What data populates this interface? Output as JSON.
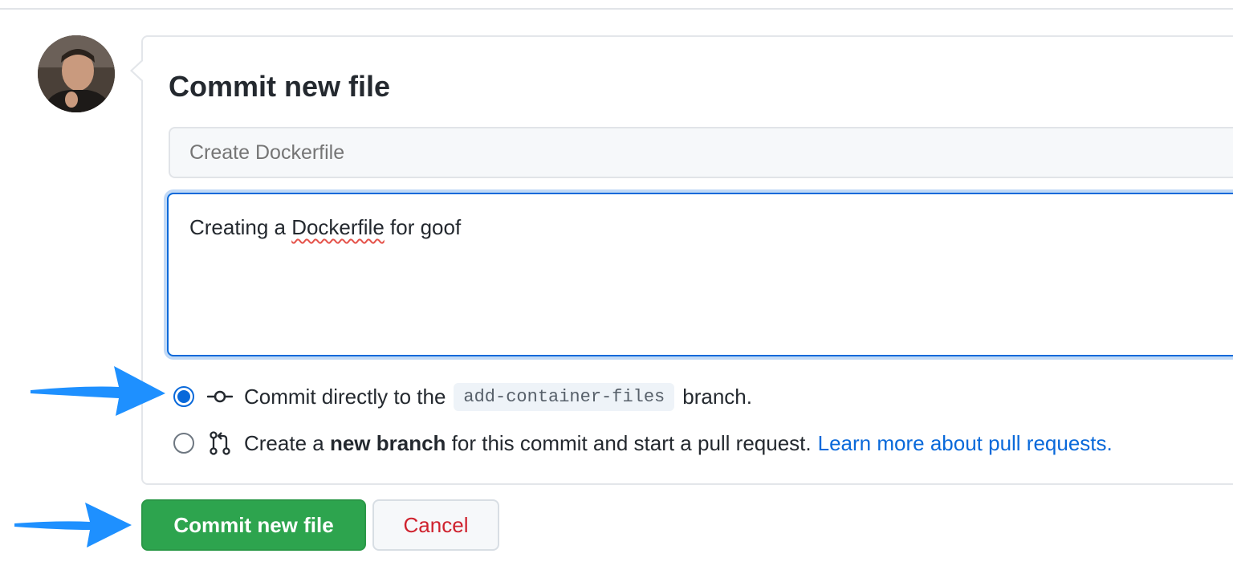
{
  "form": {
    "title": "Commit new file",
    "summary_placeholder": "Create Dockerfile",
    "description_before": "Creating a ",
    "description_misspelled": "Dockerfile",
    "description_after": " for goof"
  },
  "options": {
    "direct": {
      "prefix": "Commit directly to the",
      "branch": "add-container-files",
      "suffix": "branch.",
      "icon": "git-commit-icon",
      "selected": true
    },
    "new_branch": {
      "prefix": "Create a ",
      "bold": "new branch",
      "suffix": " for this commit and start a pull request.",
      "link": "Learn more about pull requests.",
      "icon": "git-pull-request-icon",
      "selected": false
    }
  },
  "buttons": {
    "commit": "Commit new file",
    "cancel": "Cancel"
  },
  "colors": {
    "accent": "#0969da",
    "commit_button": "#2da44e",
    "cancel_text": "#cf222e",
    "annotation_arrow": "#1e90ff"
  }
}
